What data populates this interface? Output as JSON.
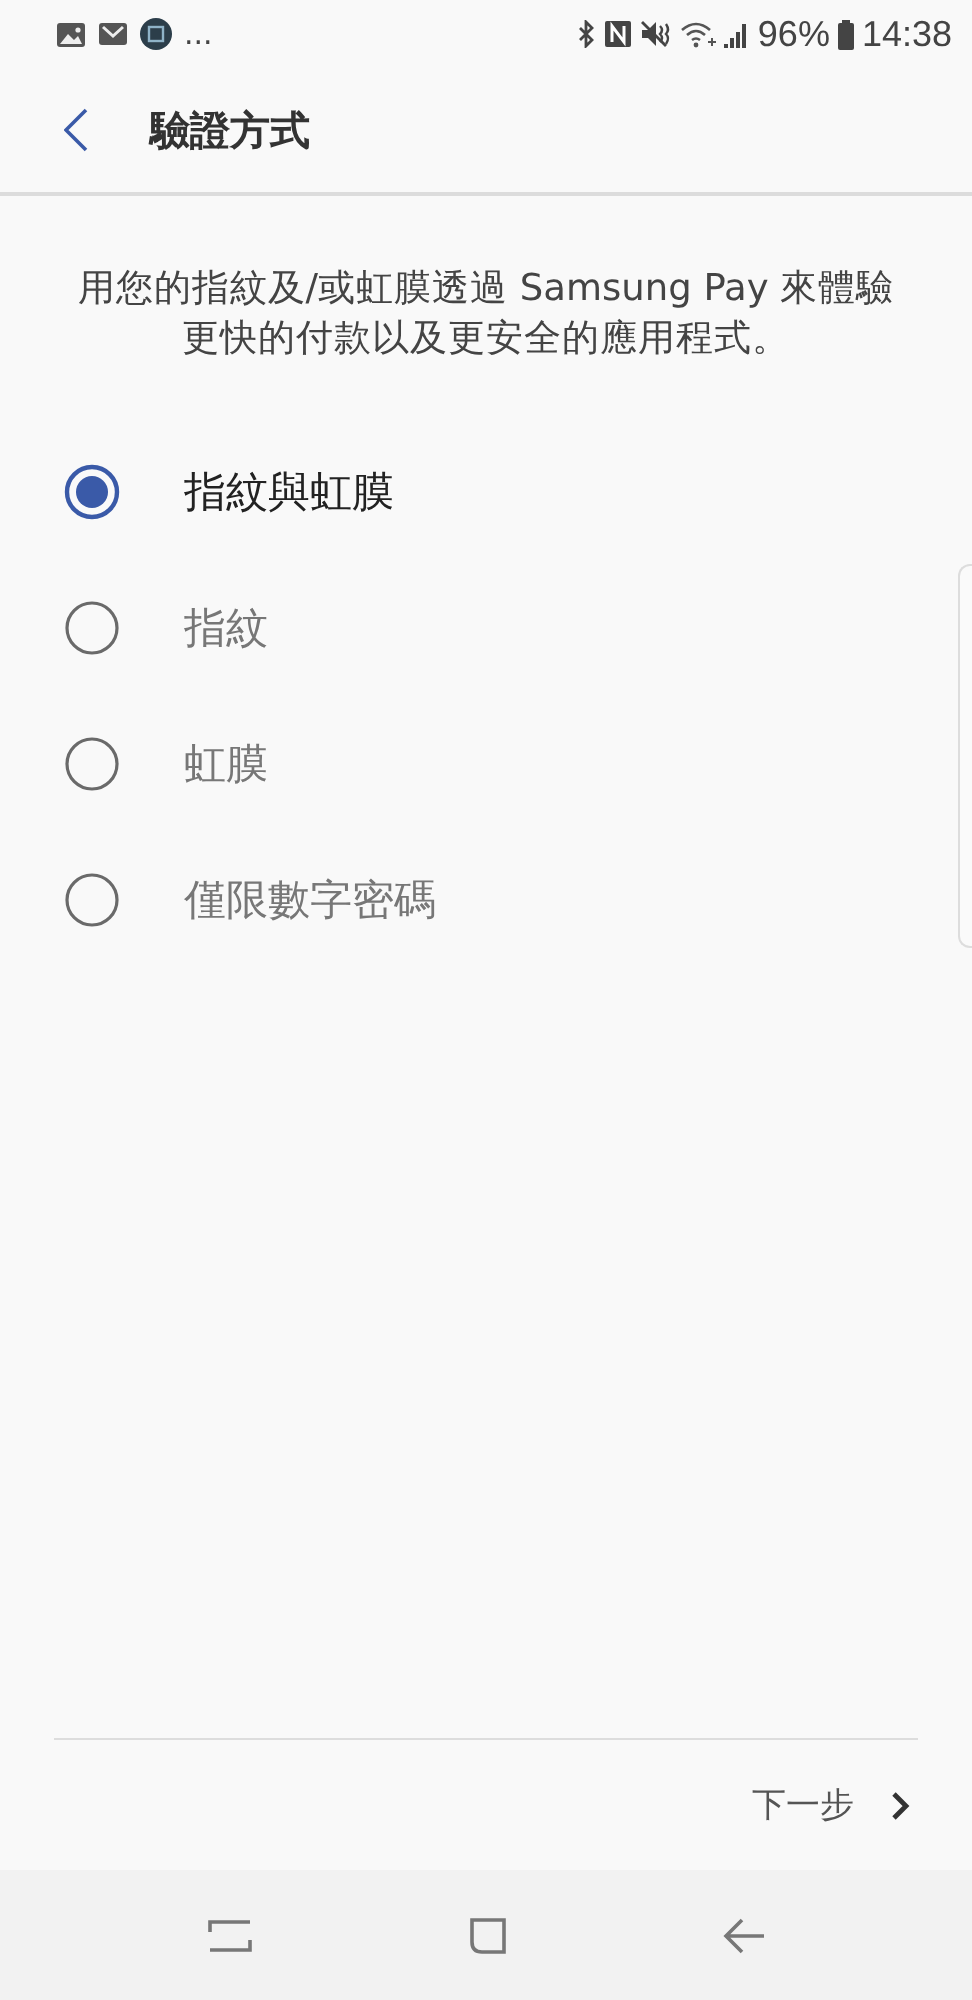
{
  "status_bar": {
    "overflow": "...",
    "battery": "96%",
    "time": "14:38"
  },
  "header": {
    "title": "驗證方式"
  },
  "description": "用您的指紋及/或虹膜透過 Samsung Pay 來體驗更快的付款以及更安全的應用程式。",
  "options": [
    {
      "label": "指紋與虹膜",
      "selected": true
    },
    {
      "label": "指紋",
      "selected": false
    },
    {
      "label": "虹膜",
      "selected": false
    },
    {
      "label": "僅限數字密碼",
      "selected": false
    }
  ],
  "footer": {
    "next_label": "下一步"
  }
}
